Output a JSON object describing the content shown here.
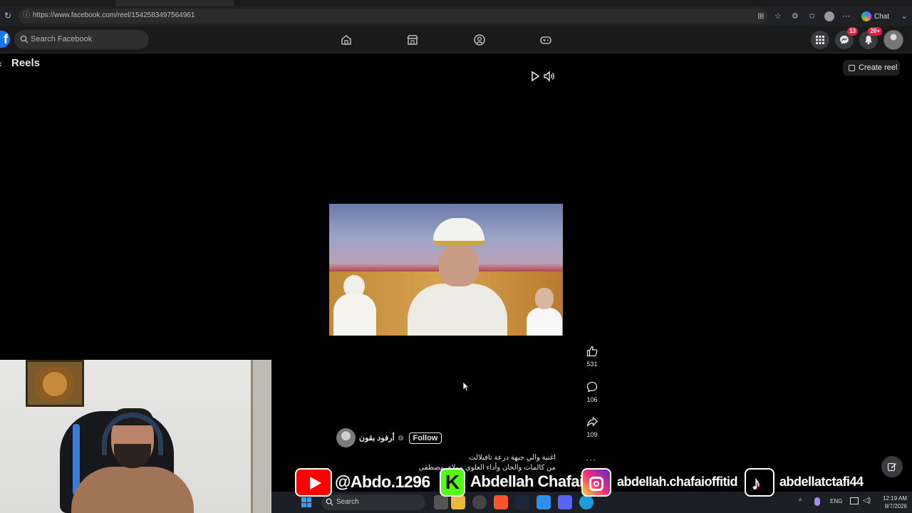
{
  "browser": {
    "url": "https://www.facebook.com/reel/1542583497564961",
    "chat_label": "Chat"
  },
  "facebook": {
    "search_placeholder": "Search Facebook",
    "messenger_badge": "13",
    "notifications_badge": "20+"
  },
  "reels": {
    "title": "Reels",
    "create_label": "Create reel",
    "likes": "531",
    "comments": "106",
    "shares": "109",
    "author_name": "أرفود بقون",
    "follow_label": "Follow",
    "caption_line1": "اغنية والي جيهة درعة تافيلالت",
    "caption_line2": "من كالمات والحان وأداء العلوي مولاي مصطفى"
  },
  "overlay": {
    "youtube_handle": "@Abdo.1296",
    "kick_letter": "K",
    "kick_name": "Abdellah Chafai",
    "instagram_handle": "abdellah.chafaioffitid",
    "tiktok_handle": "abdellatctafi44"
  },
  "taskbar": {
    "search_label": "Search",
    "language": "ENG",
    "time": "12:19 AM",
    "date": "8/7/2026"
  },
  "colors": {
    "facebook_blue": "#1877f2",
    "badge_red": "#e41e3f",
    "youtube_red": "#ff0000",
    "kick_green": "#53fc18"
  }
}
